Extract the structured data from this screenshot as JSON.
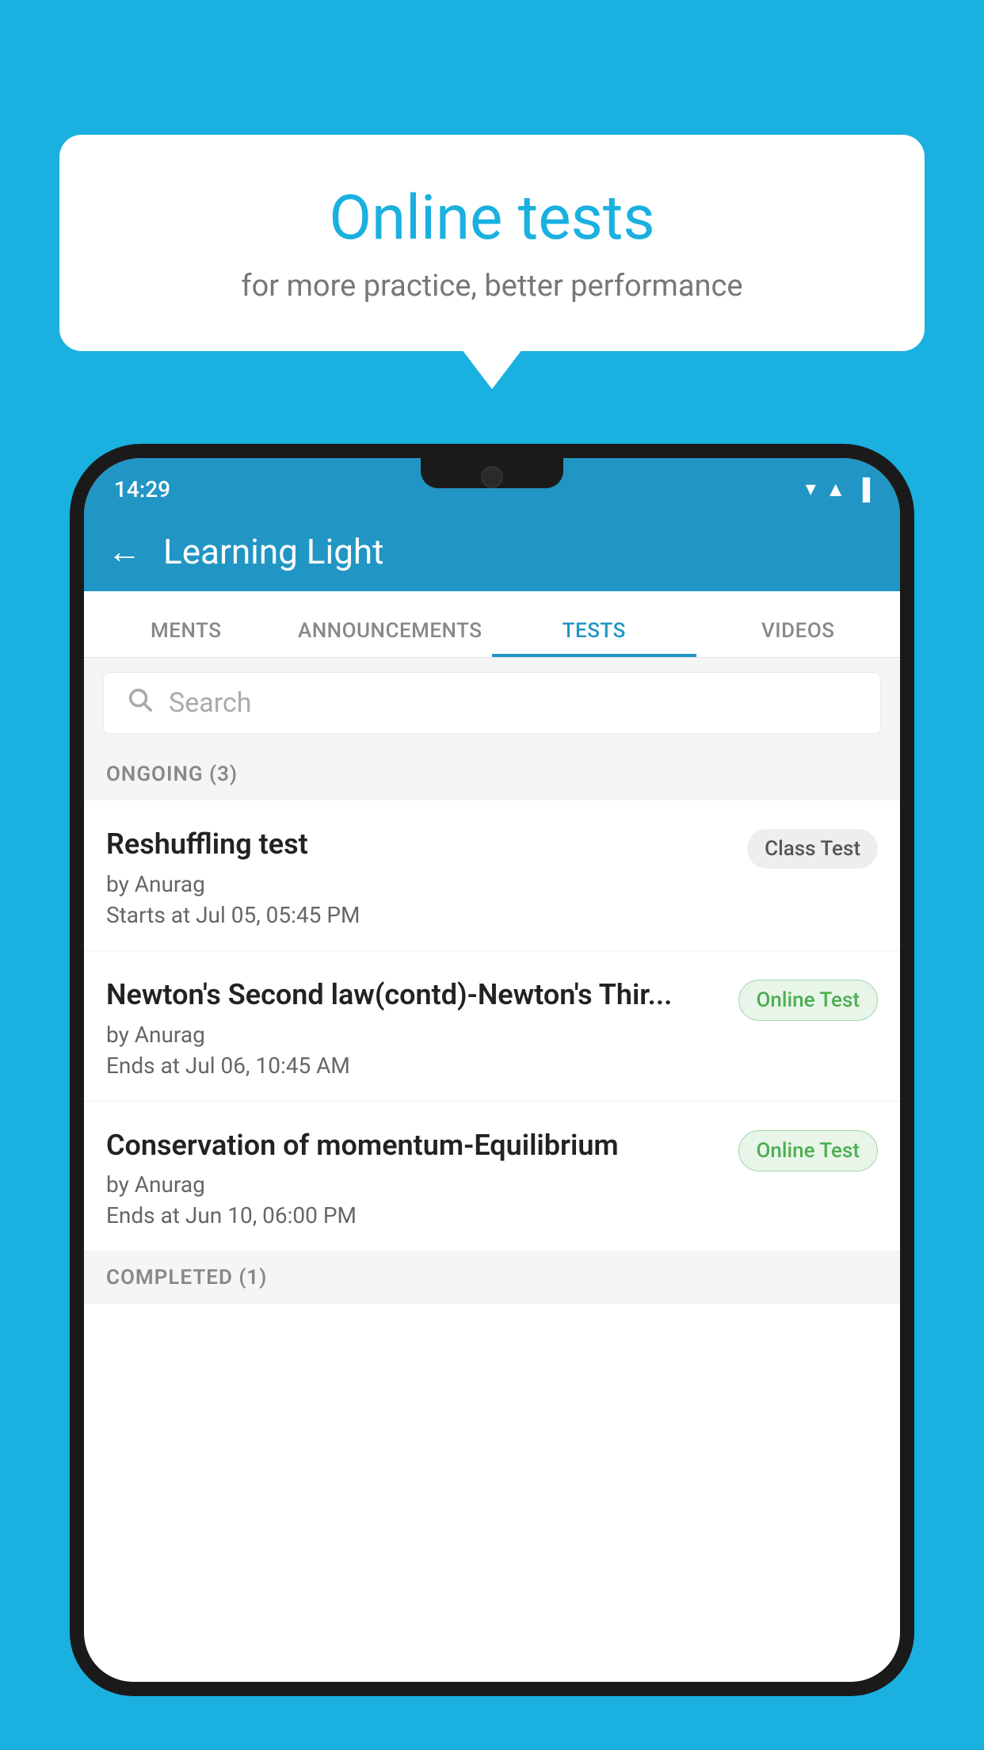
{
  "background_color": "#1ab0e0",
  "speech_bubble": {
    "title": "Online tests",
    "subtitle": "for more practice, better performance"
  },
  "phone": {
    "status_bar": {
      "time": "14:29",
      "icons": [
        "wifi",
        "signal",
        "battery"
      ]
    },
    "header": {
      "back_label": "←",
      "title": "Learning Light"
    },
    "tabs": [
      {
        "label": "MENTS",
        "active": false
      },
      {
        "label": "ANNOUNCEMENTS",
        "active": false
      },
      {
        "label": "TESTS",
        "active": true
      },
      {
        "label": "VIDEOS",
        "active": false
      }
    ],
    "search": {
      "placeholder": "Search"
    },
    "section_ongoing": {
      "label": "ONGOING (3)"
    },
    "tests": [
      {
        "name": "Reshuffling test",
        "by": "by Anurag",
        "time_label": "Starts at",
        "time": "Jul 05, 05:45 PM",
        "badge": "Class Test",
        "badge_type": "class"
      },
      {
        "name": "Newton's Second law(contd)-Newton's Thir...",
        "by": "by Anurag",
        "time_label": "Ends at",
        "time": "Jul 06, 10:45 AM",
        "badge": "Online Test",
        "badge_type": "online"
      },
      {
        "name": "Conservation of momentum-Equilibrium",
        "by": "by Anurag",
        "time_label": "Ends at",
        "time": "Jun 10, 06:00 PM",
        "badge": "Online Test",
        "badge_type": "online"
      }
    ],
    "section_completed": {
      "label": "COMPLETED (1)"
    }
  }
}
